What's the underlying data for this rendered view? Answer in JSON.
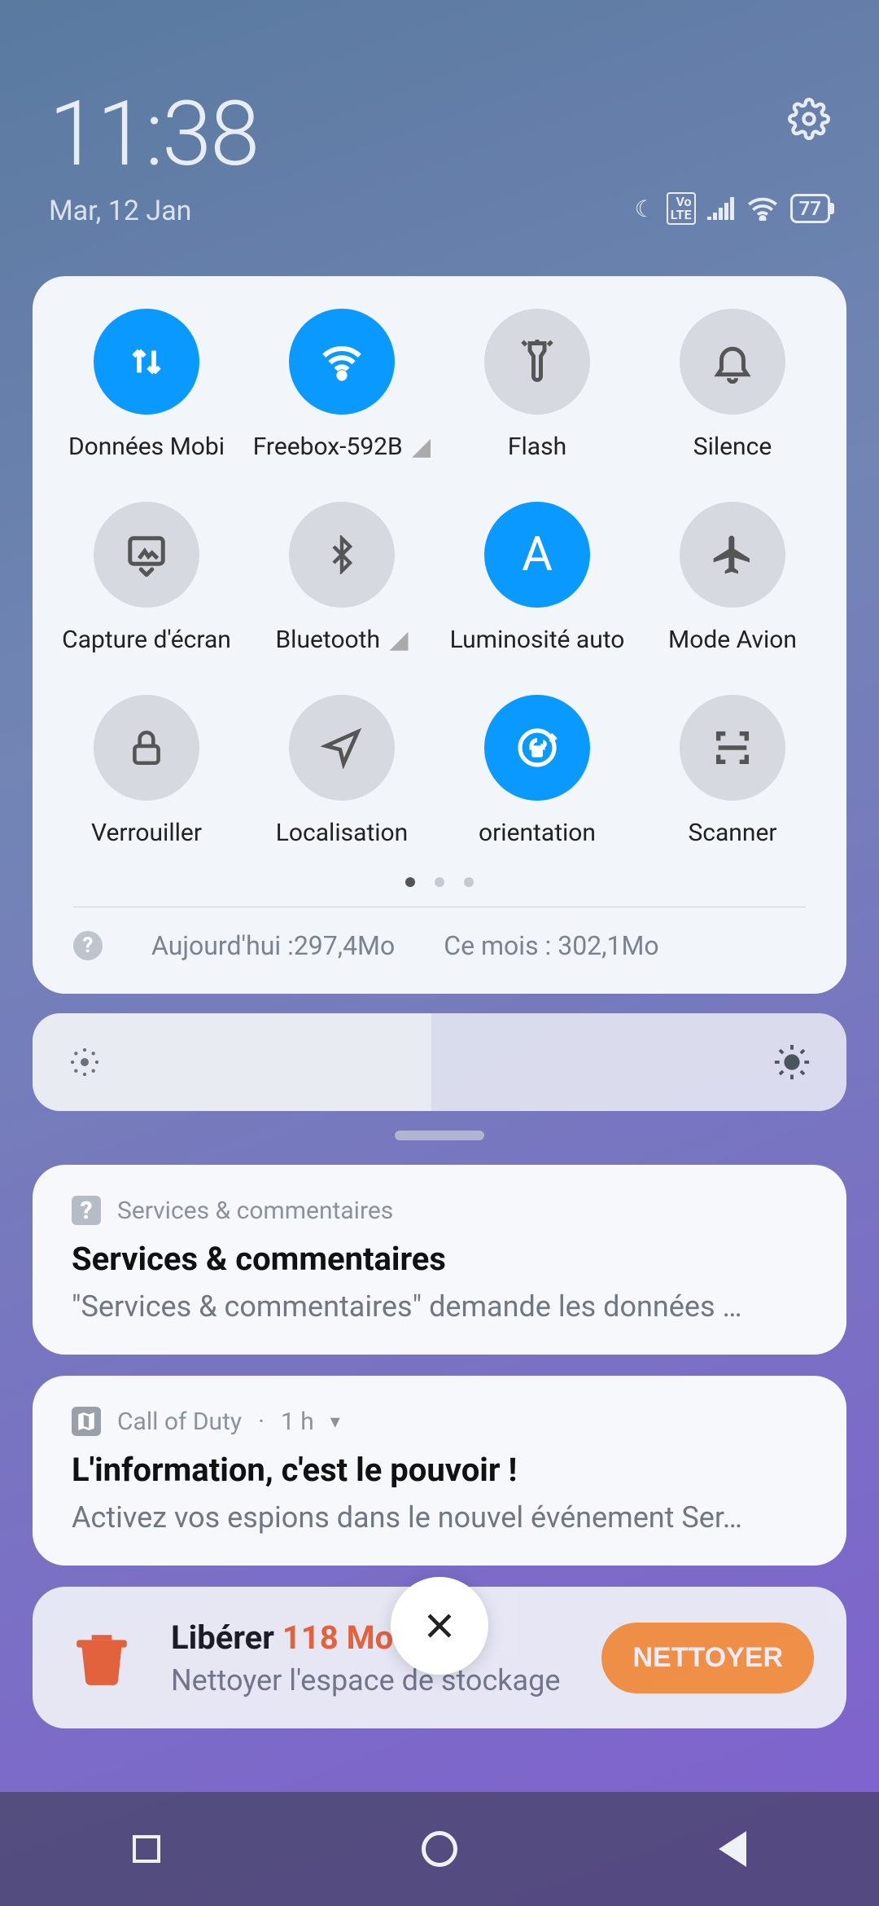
{
  "header": {
    "time": "11:38",
    "date": "Mar, 12 Jan",
    "battery": "77"
  },
  "tiles": [
    {
      "label": "Données Mobi",
      "icon": "data",
      "active": true
    },
    {
      "label": "Freebox-592B",
      "icon": "wifi",
      "active": true,
      "signal": true
    },
    {
      "label": "Flash",
      "icon": "flashlight",
      "active": false
    },
    {
      "label": "Silence",
      "icon": "bell",
      "active": false
    },
    {
      "label": "Capture d'écran",
      "icon": "screenshot",
      "active": false
    },
    {
      "label": "Bluetooth",
      "icon": "bluetooth",
      "active": false,
      "signal": true
    },
    {
      "label": "Luminosité auto",
      "icon": "letter-A",
      "active": true
    },
    {
      "label": "Mode Avion",
      "icon": "airplane",
      "active": false
    },
    {
      "label": "Verrouiller",
      "icon": "lock",
      "active": false
    },
    {
      "label": "Localisation",
      "icon": "location",
      "active": false
    },
    {
      "label": "orientation",
      "icon": "rotation-lock",
      "active": true
    },
    {
      "label": "Scanner",
      "icon": "scan",
      "active": false
    }
  ],
  "usage": {
    "today_label": "Aujourd'hui :",
    "today_value": "297,4Mo",
    "month_label": "Ce mois :",
    "month_value": "302,1Mo"
  },
  "brightness": {
    "percent": 49
  },
  "notifications": [
    {
      "app": "Services & commentaires",
      "title": "Services & commentaires",
      "body": "\"Services & commentaires\" demande les données …",
      "icon": "question"
    },
    {
      "app": "Call of Duty",
      "time": "1 h",
      "title": "L'information, c'est le pouvoir !",
      "body": "Activez vos espions dans le nouvel événement Ser…",
      "icon": "map"
    }
  ],
  "cleaner": {
    "title_prefix": "Libérer ",
    "title_value": "118 Mo",
    "subtitle": "Nettoyer l'espace de stockage",
    "button": "NETTOYER"
  }
}
